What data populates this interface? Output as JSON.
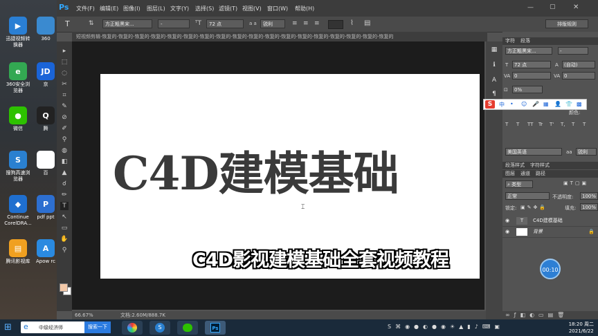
{
  "desktop": {
    "icons": [
      {
        "label": "迅捷视频转换器",
        "color": "#2a7fd4",
        "glyph": "▶"
      },
      {
        "label": "360",
        "color": "#3a8ad0",
        "glyph": ""
      },
      {
        "label": "360安全浏览器",
        "color": "#33a852",
        "glyph": "e"
      },
      {
        "label": "京",
        "color": "#1a64d8",
        "glyph": "JD"
      },
      {
        "label": "微信",
        "color": "#2dc100",
        "glyph": "●"
      },
      {
        "label": "腾",
        "color": "#222",
        "glyph": "Q"
      },
      {
        "label": "搜狗高速浏览器",
        "color": "#2a80d0",
        "glyph": "S"
      },
      {
        "label": "百",
        "color": "#fff",
        "glyph": ""
      },
      {
        "label": "Continue CorelDRA...",
        "color": "#1f6fcf",
        "glyph": "◆"
      },
      {
        "label": "pdf ppt",
        "color": "#2d6fd0",
        "glyph": "P"
      },
      {
        "label": "腾讯影视库",
        "color": "#f0a020",
        "glyph": "▤"
      },
      {
        "label": "Apow rc",
        "color": "#2a8ae0",
        "glyph": "A"
      }
    ]
  },
  "ps": {
    "logo": "Ps",
    "menu": [
      "文件(F)",
      "编辑(E)",
      "图像(I)",
      "图层(L)",
      "文字(Y)",
      "选择(S)",
      "滤镜(T)",
      "视图(V)",
      "窗口(W)",
      "帮助(H)"
    ],
    "options": {
      "font_family": "方正粗黑宋...",
      "font_style": "-",
      "font_size": "72 点",
      "aa_label": "a a",
      "aa_mode": "锐利",
      "workspace_button": "排版规则"
    },
    "doc_tab": "短视频剪辑-恢复的-恢复的-恢复的-恢复的-恢复的-恢复的-恢复的-恢复的-恢复的-恢复的-恢复的-恢复的-恢复的-恢复的-恢复的-恢复的-恢复的-恢复的",
    "canvas_text": "C4D建模基础",
    "subtitle": "C4D影视建模基础全套视频教程",
    "status": {
      "zoom": "66.67%",
      "doc": "文档:2.60M/888.7K"
    },
    "char_panel": {
      "tabs": [
        "字符",
        "段落"
      ],
      "font_family": "方正粗黑宋...",
      "font_style": "-",
      "size": "72 点",
      "leading": "(自动)",
      "kerning": "0",
      "tracking": "0",
      "scale": "0%",
      "color_label": "颜色:",
      "language": "美国英语",
      "aa": "锐利",
      "style_buttons": [
        "T",
        "T",
        "TT",
        "Tr",
        "T'",
        "T,",
        "T",
        "T"
      ]
    },
    "para_styles_tabs": [
      "段落样式",
      "字符样式"
    ],
    "layers_panel": {
      "tabs": [
        "图层",
        "通道",
        "路径"
      ],
      "filter": "类型",
      "blend": "正常",
      "opacity_label": "不透明度:",
      "opacity": "100%",
      "lock_label": "锁定:",
      "fill_label": "填充:",
      "fill": "100%",
      "layers": [
        {
          "name": "C4D建模基础",
          "type": "T"
        },
        {
          "name": "背景",
          "type": "bg"
        }
      ]
    },
    "ime_bar": [
      "中",
      "•",
      "☺",
      "🎤",
      "▦",
      "👤",
      "👕",
      "▩"
    ],
    "timer": "00:10"
  },
  "taskbar": {
    "search_text": "中级经济师",
    "search_button": "搜索一下",
    "time": "18:20 周二",
    "date": "2021/6/22"
  }
}
